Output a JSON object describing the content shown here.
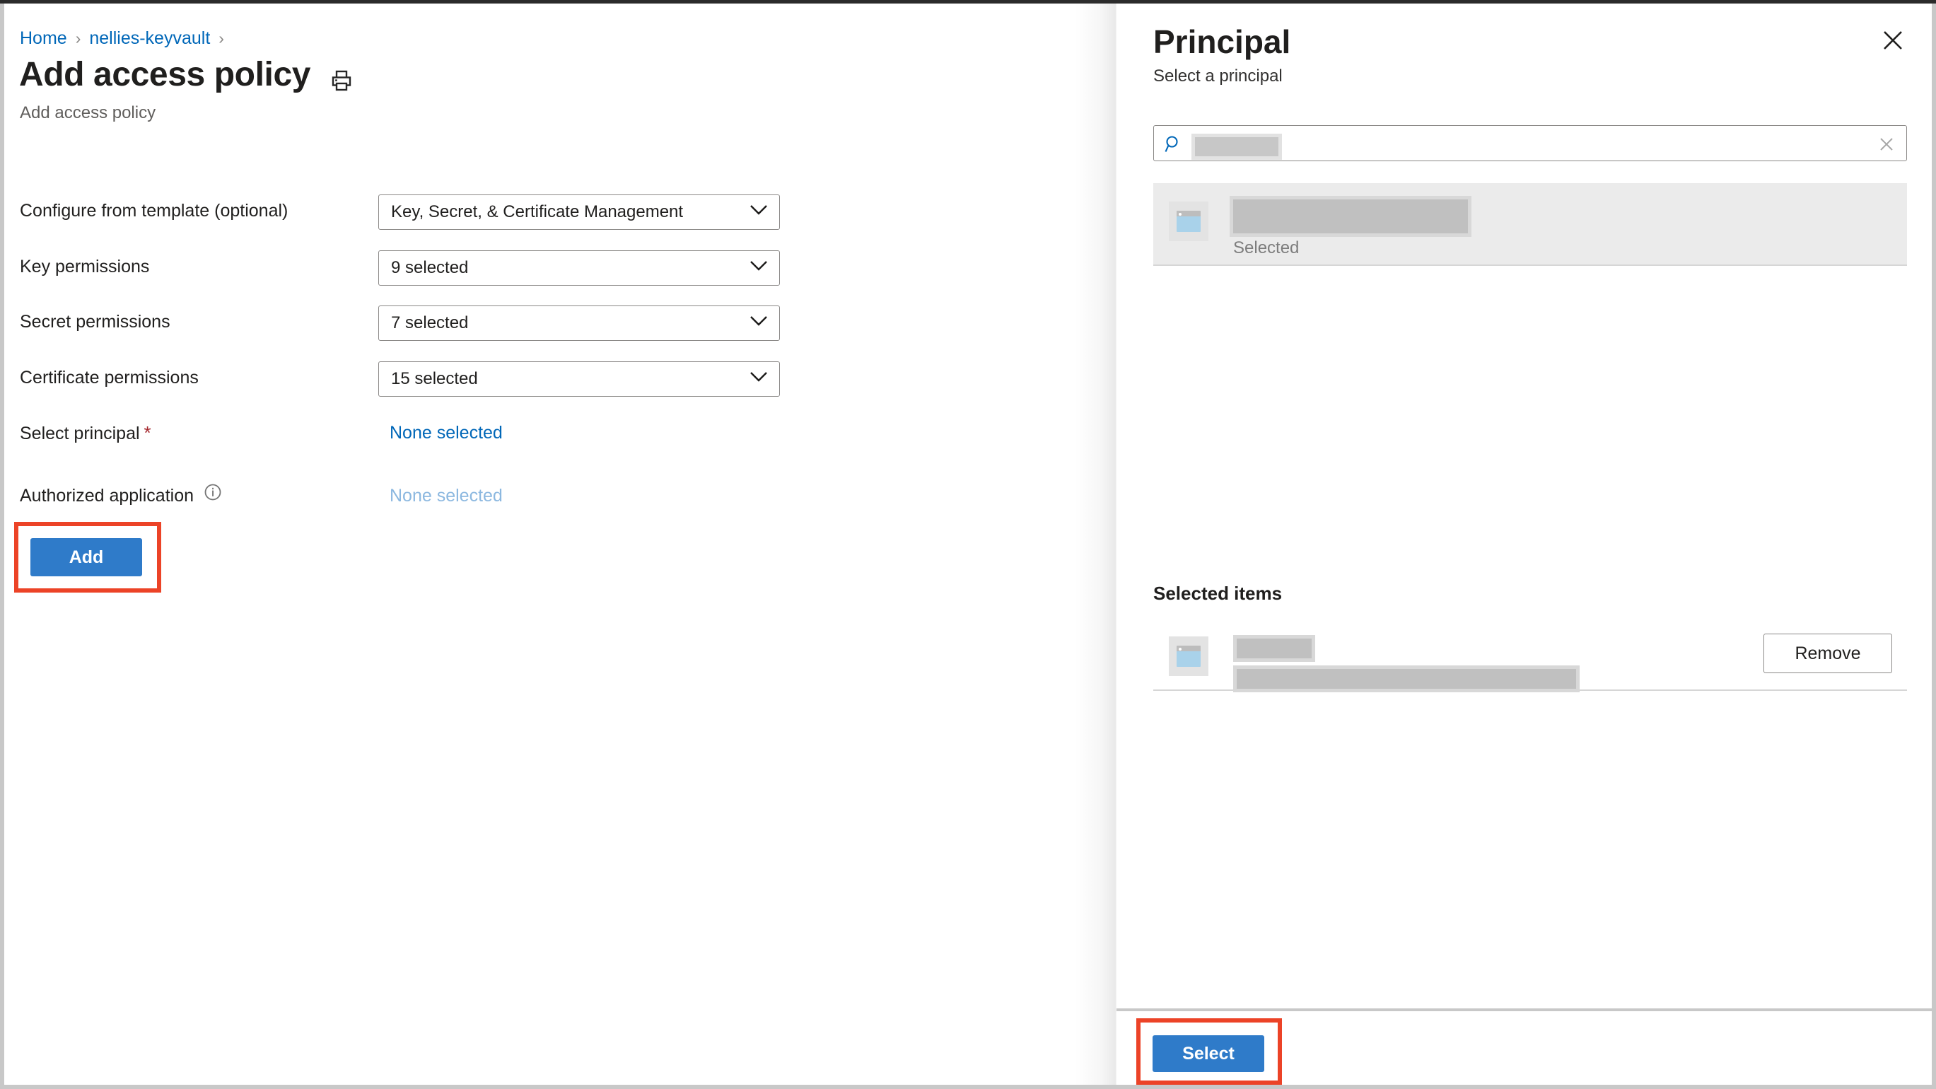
{
  "breadcrumb": {
    "items": [
      {
        "label": "Home",
        "link": true
      },
      {
        "label": "nellies-keyvault",
        "link": true
      }
    ],
    "separator": "›"
  },
  "left_blade": {
    "title": "Add access policy",
    "subtitle": "Add access policy",
    "print_icon": "print-icon",
    "form_rows": [
      {
        "label": "Configure from template (optional)",
        "control": "dropdown",
        "value": "Key, Secret, & Certificate Management"
      },
      {
        "label": "Key permissions",
        "control": "dropdown",
        "value": "9 selected"
      },
      {
        "label": "Secret permissions",
        "control": "dropdown",
        "value": "7 selected"
      },
      {
        "label": "Certificate permissions",
        "control": "dropdown",
        "value": "15 selected"
      },
      {
        "label": "Select principal",
        "required": true,
        "control": "link",
        "value": "None selected"
      },
      {
        "label": "Authorized application",
        "info": true,
        "control": "link-muted",
        "value": "None selected"
      }
    ],
    "add_button": "Add"
  },
  "right_blade": {
    "title": "Principal",
    "subtitle": "Select a principal",
    "close_icon": "close-icon",
    "search": {
      "icon": "search-icon",
      "value": "",
      "placeholder": "",
      "clear_icon": "clear-icon",
      "redacted": true
    },
    "results": [
      {
        "icon": "app-icon",
        "name": "",
        "name_redacted": true,
        "status": "Selected"
      }
    ],
    "selected_items": {
      "heading": "Selected items",
      "rows": [
        {
          "icon": "app-icon",
          "name": "",
          "detail": "",
          "redacted": true,
          "remove_label": "Remove"
        }
      ]
    },
    "select_button": "Select"
  },
  "colors": {
    "accent_blue": "#2f7bc9",
    "link_blue": "#0067b8",
    "highlight_red": "#ec4327",
    "required_red": "#a4262c",
    "border_gray": "#8a8886"
  }
}
